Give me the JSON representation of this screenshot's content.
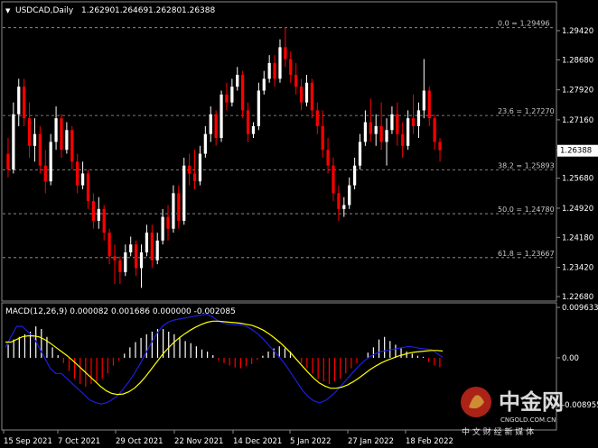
{
  "window": {
    "symbol": "USDCAD,Daily",
    "ohlc": [
      "1.26290",
      "1.26469",
      "1.26280",
      "1.26388"
    ],
    "menu_glyph": "▼"
  },
  "colors": {
    "background": "#000000",
    "bull": "#ffffff",
    "bear": "#ff0000",
    "grid": "#5a5a5a",
    "fib_line": "#a0a0a0",
    "macd_line": "#1e1edc",
    "signal_line": "#ffff00",
    "price_tag_bg": "#ffffff",
    "price_tag_fg": "#000000"
  },
  "price_axis": {
    "ticks": [
      "1.29420",
      "1.28680",
      "1.27920",
      "1.27160",
      "1.26388",
      "1.25680",
      "1.24920",
      "1.24180",
      "1.23420",
      "1.22680"
    ],
    "current_price": "1.26388"
  },
  "fibonacci": [
    {
      "label": "0.0 = 1.29496",
      "price": 1.29496
    },
    {
      "label": "23.6 = 1.27270",
      "price": 1.2727
    },
    {
      "label": "38.2 = 1.25893",
      "price": 1.25893
    },
    {
      "label": "50.0 = 1.24780",
      "price": 1.2478
    },
    {
      "label": "61.8 = 1.23667",
      "price": 1.23667
    }
  ],
  "macd": {
    "title": "MACD(12,26,9) 0.000082 0.001686 0.000000 -0.002085",
    "ticks": [
      "0.009633",
      "0.00",
      "-0.008955"
    ],
    "values": [
      0.009633,
      0.0,
      -0.008955
    ]
  },
  "time_axis": [
    "15 Sep 2021",
    "7 Oct 2021",
    "29 Oct 2021",
    "22 Nov 2021",
    "14 Dec 2021",
    "5 Jan 2022",
    "27 Jan 2022",
    "18 Feb 2022"
  ],
  "watermark": {
    "brand": "中金网",
    "domain": "CNGOLD.COM.CN",
    "slogan": "中 文 财 经 新 媒 体"
  },
  "chart_data": [
    {
      "type": "candlestick",
      "title": "USDCAD,Daily",
      "x": [
        "2021-09-15",
        "2021-10-07",
        "2021-10-29",
        "2021-11-22",
        "2021-12-14",
        "2022-01-05",
        "2022-01-27",
        "2022-02-18"
      ],
      "ylim": [
        1.2268,
        1.2978
      ],
      "series": [
        {
          "values": [
            [
              1.263,
              1.267,
              1.257,
              1.259
            ],
            [
              1.259,
              1.276,
              1.258,
              1.273
            ],
            [
              1.273,
              1.282,
              1.27,
              1.28
            ],
            [
              1.28,
              1.282,
              1.27,
              1.272
            ],
            [
              1.272,
              1.276,
              1.262,
              1.265
            ],
            [
              1.265,
              1.272,
              1.261,
              1.268
            ],
            [
              1.268,
              1.27,
              1.258,
              1.26
            ],
            [
              1.26,
              1.264,
              1.253,
              1.256
            ],
            [
              1.256,
              1.268,
              1.255,
              1.266
            ],
            [
              1.266,
              1.275,
              1.264,
              1.272
            ],
            [
              1.272,
              1.273,
              1.262,
              1.264
            ],
            [
              1.264,
              1.271,
              1.263,
              1.269
            ],
            [
              1.269,
              1.27,
              1.259,
              1.261
            ],
            [
              1.261,
              1.263,
              1.253,
              1.255
            ],
            [
              1.255,
              1.261,
              1.254,
              1.258
            ],
            [
              1.258,
              1.259,
              1.249,
              1.251
            ],
            [
              1.251,
              1.253,
              1.244,
              1.246
            ],
            [
              1.246,
              1.252,
              1.244,
              1.249
            ],
            [
              1.249,
              1.25,
              1.241,
              1.243
            ],
            [
              1.243,
              1.244,
              1.235,
              1.237
            ],
            [
              1.237,
              1.24,
              1.23,
              1.236
            ],
            [
              1.236,
              1.237,
              1.23,
              1.233
            ],
            [
              1.233,
              1.24,
              1.232,
              1.238
            ],
            [
              1.238,
              1.242,
              1.237,
              1.24
            ],
            [
              1.24,
              1.241,
              1.232,
              1.234
            ],
            [
              1.234,
              1.24,
              1.229,
              1.238
            ],
            [
              1.238,
              1.245,
              1.237,
              1.243
            ],
            [
              1.243,
              1.245,
              1.234,
              1.236
            ],
            [
              1.236,
              1.243,
              1.235,
              1.241
            ],
            [
              1.241,
              1.249,
              1.24,
              1.247
            ],
            [
              1.247,
              1.25,
              1.241,
              1.244
            ],
            [
              1.244,
              1.255,
              1.243,
              1.253
            ],
            [
              1.253,
              1.255,
              1.244,
              1.246
            ],
            [
              1.246,
              1.262,
              1.245,
              1.26
            ],
            [
              1.26,
              1.263,
              1.255,
              1.258
            ],
            [
              1.258,
              1.264,
              1.254,
              1.256
            ],
            [
              1.256,
              1.265,
              1.255,
              1.263
            ],
            [
              1.263,
              1.27,
              1.262,
              1.268
            ],
            [
              1.268,
              1.275,
              1.266,
              1.273
            ],
            [
              1.273,
              1.274,
              1.265,
              1.267
            ],
            [
              1.267,
              1.279,
              1.266,
              1.278
            ],
            [
              1.278,
              1.281,
              1.274,
              1.276
            ],
            [
              1.276,
              1.282,
              1.275,
              1.28
            ],
            [
              1.28,
              1.285,
              1.279,
              1.283
            ],
            [
              1.283,
              1.284,
              1.272,
              1.274
            ],
            [
              1.274,
              1.276,
              1.266,
              1.268
            ],
            [
              1.268,
              1.271,
              1.267,
              1.27
            ],
            [
              1.27,
              1.281,
              1.269,
              1.279
            ],
            [
              1.279,
              1.284,
              1.278,
              1.282
            ],
            [
              1.282,
              1.288,
              1.281,
              1.286
            ],
            [
              1.286,
              1.288,
              1.28,
              1.282
            ],
            [
              1.282,
              1.292,
              1.281,
              1.29
            ],
            [
              1.29,
              1.295,
              1.285,
              1.287
            ],
            [
              1.287,
              1.289,
              1.281,
              1.283
            ],
            [
              1.283,
              1.286,
              1.278,
              1.28
            ],
            [
              1.28,
              1.282,
              1.274,
              1.276
            ],
            [
              1.276,
              1.283,
              1.275,
              1.281
            ],
            [
              1.281,
              1.282,
              1.272,
              1.274
            ],
            [
              1.274,
              1.276,
              1.268,
              1.27
            ],
            [
              1.27,
              1.274,
              1.262,
              1.264
            ],
            [
              1.264,
              1.267,
              1.258,
              1.26
            ],
            [
              1.26,
              1.262,
              1.251,
              1.253
            ],
            [
              1.253,
              1.255,
              1.246,
              1.249
            ],
            [
              1.249,
              1.252,
              1.247,
              1.25
            ],
            [
              1.25,
              1.257,
              1.249,
              1.255
            ],
            [
              1.255,
              1.262,
              1.254,
              1.26
            ],
            [
              1.26,
              1.268,
              1.259,
              1.266
            ],
            [
              1.266,
              1.274,
              1.265,
              1.271
            ],
            [
              1.271,
              1.277,
              1.266,
              1.268
            ],
            [
              1.268,
              1.273,
              1.265,
              1.27
            ],
            [
              1.27,
              1.276,
              1.264,
              1.266
            ],
            [
              1.266,
              1.272,
              1.26,
              1.269
            ],
            [
              1.269,
              1.275,
              1.268,
              1.273
            ],
            [
              1.273,
              1.276,
              1.265,
              1.268
            ],
            [
              1.268,
              1.271,
              1.262,
              1.265
            ],
            [
              1.265,
              1.274,
              1.264,
              1.272
            ],
            [
              1.272,
              1.278,
              1.268,
              1.27
            ],
            [
              1.27,
              1.276,
              1.267,
              1.274
            ],
            [
              1.274,
              1.287,
              1.272,
              1.279
            ],
            [
              1.279,
              1.28,
              1.27,
              1.272
            ],
            [
              1.272,
              1.273,
              1.264,
              1.266
            ],
            [
              1.266,
              1.267,
              1.261,
              1.2639
            ]
          ]
        }
      ]
    },
    {
      "type": "bar",
      "title": "MACD(12,26,9) 0.000082 0.001686 0.000000 -0.002085",
      "series": [
        {
          "name": "MACD",
          "values": [
            0.002,
            0.004,
            0.006,
            0.006,
            0.005,
            0.004,
            0.002,
            0.0,
            -0.002,
            -0.003,
            -0.003,
            -0.004,
            -0.005,
            -0.006,
            -0.007,
            -0.008,
            -0.0085,
            -0.0088,
            -0.0086,
            -0.008,
            -0.0072,
            -0.006,
            -0.0046,
            -0.003,
            -0.0012,
            0.0008,
            0.0028,
            0.0046,
            0.006,
            0.0068,
            0.0072,
            0.0074,
            0.0076,
            0.0078,
            0.008,
            0.0082,
            0.0083,
            0.0078,
            0.007,
            0.0066,
            0.0064,
            0.0063,
            0.0063,
            0.006,
            0.0054,
            0.0046,
            0.0036,
            0.0024,
            0.0012,
            0.0,
            -0.0014,
            -0.003,
            -0.0046,
            -0.0062,
            -0.0074,
            -0.0082,
            -0.0086,
            -0.0082,
            -0.0074,
            -0.0064,
            -0.0052,
            -0.004,
            -0.0028,
            -0.0016,
            -0.0006,
            0.0002,
            0.0008,
            0.0012,
            0.0014,
            0.0016,
            0.0018,
            0.002,
            0.0022,
            0.002,
            0.0018,
            0.0017,
            0.0016,
            0.0008,
            0.0001
          ]
        },
        {
          "name": "Signal",
          "values": [
            0.003,
            0.003,
            0.0035,
            0.004,
            0.0042,
            0.0042,
            0.004,
            0.0035,
            0.0028,
            0.002,
            0.0012,
            0.0004,
            -0.0005,
            -0.0015,
            -0.0025,
            -0.0035,
            -0.0045,
            -0.0055,
            -0.0063,
            -0.0068,
            -0.007,
            -0.0069,
            -0.0065,
            -0.0058,
            -0.0048,
            -0.0036,
            -0.0022,
            -0.0008,
            0.0006,
            0.0018,
            0.0029,
            0.0038,
            0.0046,
            0.0053,
            0.0059,
            0.0064,
            0.0068,
            0.007,
            0.007,
            0.0069,
            0.0068,
            0.0067,
            0.0066,
            0.0064,
            0.0062,
            0.0058,
            0.0053,
            0.0046,
            0.0038,
            0.0029,
            0.0019,
            0.0008,
            -0.0004,
            -0.0016,
            -0.0028,
            -0.0039,
            -0.0048,
            -0.0054,
            -0.0058,
            -0.0058,
            -0.0056,
            -0.0052,
            -0.0046,
            -0.0039,
            -0.0031,
            -0.0023,
            -0.0016,
            -0.001,
            -0.0005,
            -0.0001,
            0.0003,
            0.0006,
            0.0009,
            0.0011,
            0.0012,
            0.0013,
            0.0014,
            0.0014,
            0.0013
          ]
        },
        {
          "name": "Histogram",
          "values": [
            0.0025,
            0.0035,
            0.004,
            0.0045,
            0.005,
            0.006,
            0.0055,
            0.004,
            0.002,
            0.0005,
            -0.001,
            -0.0025,
            -0.004,
            -0.005,
            -0.0055,
            -0.005,
            -0.0045,
            -0.004,
            -0.003,
            -0.0015,
            -0.0005,
            0.0008,
            0.002,
            0.003,
            0.0038,
            0.0045,
            0.005,
            0.0055,
            0.0055,
            0.005,
            0.0045,
            0.004,
            0.0032,
            0.0028,
            0.0022,
            0.0016,
            0.0012,
            0.0005,
            -0.0005,
            -0.001,
            -0.0015,
            -0.0018,
            -0.002,
            -0.0016,
            -0.0012,
            -0.0004,
            0.0004,
            0.0012,
            0.0018,
            0.0022,
            0.0018,
            0.0012,
            0.0,
            -0.001,
            -0.002,
            -0.003,
            -0.004,
            -0.0045,
            -0.005,
            -0.0045,
            -0.004,
            -0.003,
            -0.002,
            -0.001,
            0.0,
            0.001,
            0.002,
            0.0035,
            0.004,
            0.0032,
            0.0025,
            0.0018,
            0.0012,
            0.0008,
            0.0004,
            0.0002,
            -0.0008,
            -0.0014,
            -0.0018
          ]
        }
      ]
    }
  ]
}
